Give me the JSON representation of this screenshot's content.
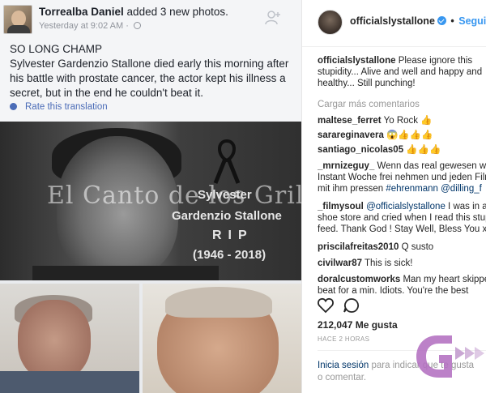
{
  "facebook": {
    "author": "Torrealba Daniel",
    "action": " added 3 new photos.",
    "timestamp": "Yesterday at 9:02 AM",
    "body_title": "SO LONG CHAMP",
    "body_text": "Sylvester Gardenzio Stallone died early this morning after his battle with prostate cancer, the actor kept his illness a secret, but in the end he couldn't beat it.",
    "translate": "Rate this translation",
    "image_text": {
      "watermark": "El Canto de los Grillos",
      "name_line1": "Sylvester",
      "name_line2": "Gardenzio Stallone",
      "rip": "RIP",
      "years": "(1946 - 2018)"
    }
  },
  "instagram": {
    "username": "officialslystallone",
    "follow": "Seguir",
    "caption_user": "officialslystallone",
    "caption_text": " Please ignore this stupidity... Alive and well and happy and healthy... Still punching!",
    "load_more": "Cargar más comentarios",
    "comments": [
      {
        "user": "maltese_ferret",
        "text": " Yo Rock 👍"
      },
      {
        "user": "sarareginavera",
        "text": " 😱👍👍👍"
      },
      {
        "user": "santiago_nicolas05",
        "text": " 👍👍👍"
      },
      {
        "user": "_mrnizeguy_",
        "text": " Wenn das real gewesen wäre Instant Woche frei nehmen und jeden Film mit ihm pressen ",
        "links": "#ehrenmann @dilling_f"
      },
      {
        "user": "_filmysoul",
        "text": " ",
        "mention": "@officialslystallone",
        "text2": " I was in a shoe store and cried when I read this stupid feed. Thank God ! Stay Well, Bless You x"
      },
      {
        "user": "priscilafreitas2010",
        "text": " Q susto"
      },
      {
        "user": "civilwar87",
        "text": " This is sick!"
      },
      {
        "user": "doralcustomworks",
        "text": " Man my heart skipped a beat for a min. Idiots. You're the best"
      }
    ],
    "likes": "212,047 Me gusta",
    "time_ago": "HACE 2 HORAS",
    "login_link": "Inicia sesión",
    "login_text": " para indicar que te gusta o comentar."
  },
  "colors": {
    "fb_link": "#4b6cb7",
    "ig_blue": "#3897f0",
    "ig_text": "#262626",
    "logo_purple": "#b36fc0"
  },
  "icons": [
    "globe-icon",
    "add-friend-icon",
    "gear-icon",
    "verified-badge-icon",
    "heart-icon",
    "comment-icon",
    "ribbon-icon",
    "brand-logo"
  ]
}
